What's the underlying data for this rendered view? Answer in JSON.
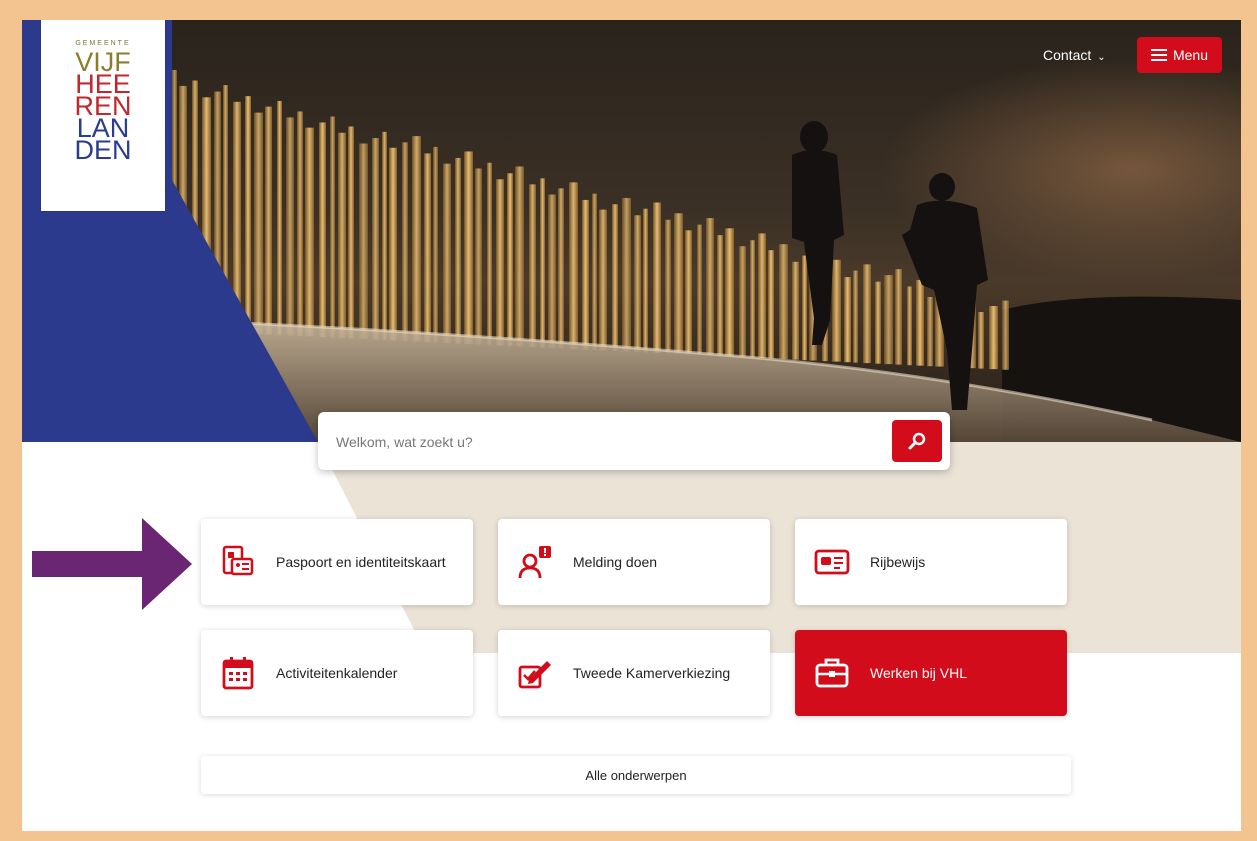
{
  "logo": {
    "small": "GEMEENTE",
    "lines": [
      {
        "text": "VIJF",
        "color": "#8a7d2e"
      },
      {
        "text": "HEE",
        "color": "#c1272d"
      },
      {
        "text": "REN",
        "color": "#c1272d"
      },
      {
        "text": "LAN",
        "color": "#2a3c8f"
      },
      {
        "text": "DEN",
        "color": "#2a3c8f"
      }
    ]
  },
  "header": {
    "contact_label": "Contact",
    "menu_label": "Menu"
  },
  "search": {
    "placeholder": "Welkom, wat zoekt u?"
  },
  "tiles": [
    {
      "label": "Paspoort en identiteitskaart",
      "icon": "passport-id-icon"
    },
    {
      "label": "Melding doen",
      "icon": "report-person-icon"
    },
    {
      "label": "Rijbewijs",
      "icon": "driving-license-icon"
    },
    {
      "label": "Activiteitenkalender",
      "icon": "calendar-icon"
    },
    {
      "label": "Tweede Kamerverkiezing",
      "icon": "ballot-pen-icon"
    },
    {
      "label": "Werken bij VHL",
      "icon": "briefcase-icon"
    }
  ],
  "all_topics_label": "Alle onderwerpen",
  "colors": {
    "brand_red": "#d20c1a",
    "brand_blue": "#2b3a8c",
    "beige": "#ebe3d6",
    "frame": "#f3c48f",
    "arrow": "#6b2673"
  }
}
